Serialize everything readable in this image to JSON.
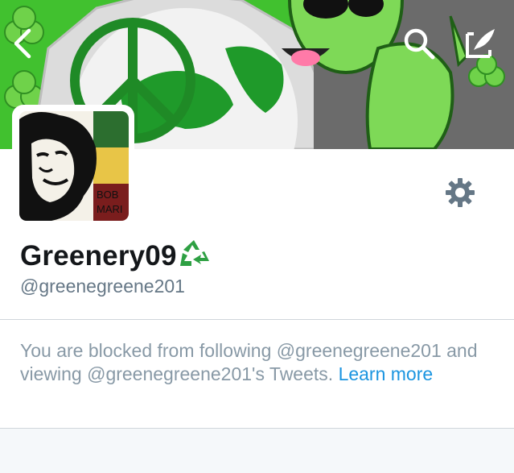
{
  "header": {
    "back_icon": "chevron-left-icon",
    "search_icon": "search-icon",
    "compose_icon": "compose-icon"
  },
  "banner": {
    "colors": {
      "grass": "#3dbd2e",
      "globe": "#1f9a2a",
      "alien": "#7ed957",
      "frame": "#d9d9d9"
    }
  },
  "avatar": {
    "label_line1": "BOB",
    "label_line2": "MARI",
    "colors": {
      "green": "#2c6e2f",
      "yellow": "#e8c547",
      "red": "#7a1d1d"
    }
  },
  "profile": {
    "display_name": "Greenery09",
    "name_emoji": "recycle-icon",
    "handle": "@greenegreene201",
    "settings_icon": "gear-icon"
  },
  "blocked_notice": {
    "line": "You are blocked from following @greenegreene201 and viewing @greenegreene201's Tweets.",
    "link": "Learn more"
  },
  "colors": {
    "text_primary": "#14171a",
    "text_secondary": "#657786",
    "notice_text": "#8899a6",
    "link": "#1b95e0",
    "gear": "#657786",
    "recycle": "#2ea043"
  }
}
